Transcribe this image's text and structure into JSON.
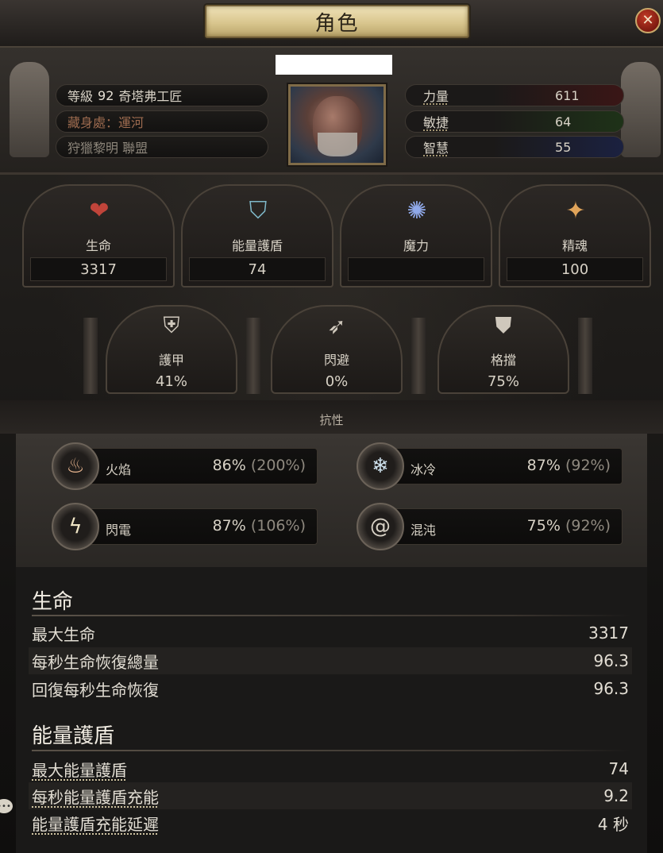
{
  "window": {
    "title": "角色"
  },
  "header": {
    "level_label": "等級",
    "level_value": "92",
    "class_name": "奇塔弗工匠",
    "stash_location": "藏身處：運河",
    "league": "狩獵黎明 聯盟"
  },
  "attributes": [
    {
      "label": "力量",
      "value": "611"
    },
    {
      "label": "敏捷",
      "value": "64"
    },
    {
      "label": "智慧",
      "value": "55"
    }
  ],
  "pools": [
    {
      "icon": "heart-icon",
      "label": "生命",
      "value": "3317"
    },
    {
      "icon": "energy-shield-icon",
      "label": "能量護盾",
      "value": "74"
    },
    {
      "icon": "mana-icon",
      "label": "魔力",
      "value": ""
    },
    {
      "icon": "spirit-icon",
      "label": "精魂",
      "value": "100"
    }
  ],
  "defences": [
    {
      "icon": "armour-icon",
      "label": "護甲",
      "value": "41%"
    },
    {
      "icon": "evasion-icon",
      "label": "閃避",
      "value": "0%"
    },
    {
      "icon": "block-icon",
      "label": "格擋",
      "value": "75%"
    }
  ],
  "resistances": {
    "title": "抗性",
    "items": [
      {
        "icon": "fire-icon",
        "label": "火焰",
        "value": "86%",
        "cap": "(200%)"
      },
      {
        "icon": "cold-icon",
        "label": "冰冷",
        "value": "87%",
        "cap": "(92%)"
      },
      {
        "icon": "lightning-icon",
        "label": "閃電",
        "value": "87%",
        "cap": "(106%)"
      },
      {
        "icon": "chaos-icon",
        "label": "混沌",
        "value": "75%",
        "cap": "(92%)"
      }
    ]
  },
  "life_section": {
    "title": "生命",
    "rows": [
      {
        "label": "最大生命",
        "value": "3317"
      },
      {
        "label": "每秒生命恢復總量",
        "value": "96.3"
      },
      {
        "label": "回復每秒生命恢復",
        "value": "96.3"
      }
    ]
  },
  "es_section": {
    "title": "能量護盾",
    "rows": [
      {
        "label": "最大能量護盾",
        "value": "74"
      },
      {
        "label": "每秒能量護盾充能",
        "value": "9.2"
      },
      {
        "label": "能量護盾充能延遲",
        "value": "4 秒"
      }
    ]
  },
  "colors": {
    "title_plate": "#d9c68e",
    "close_button": "#a12a1a",
    "text": "#d8d2c6"
  }
}
